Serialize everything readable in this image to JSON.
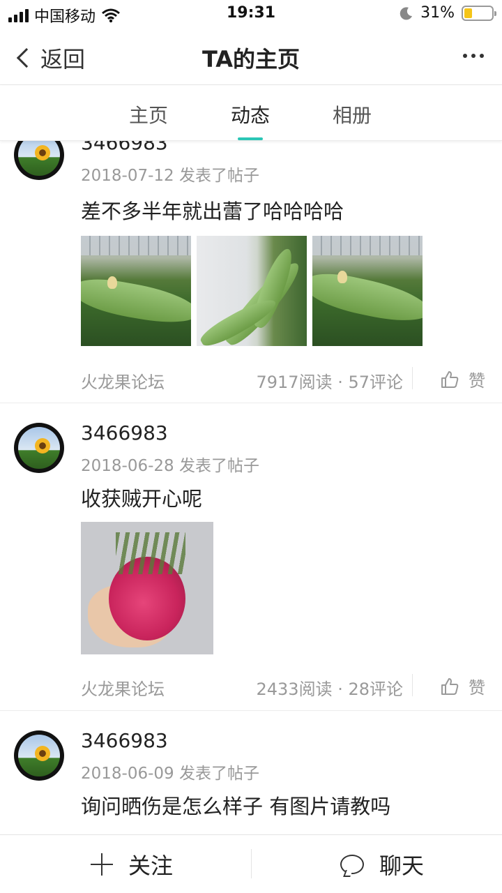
{
  "status_bar": {
    "carrier": "中国移动",
    "time": "19:31",
    "battery": "31%",
    "battery_level": 0.31,
    "icons": [
      "signal-icon",
      "wifi-icon",
      "moon-icon",
      "battery-icon"
    ]
  },
  "nav": {
    "back_label": "返回",
    "title": "TA的主页"
  },
  "tabs": [
    {
      "label": "主页",
      "active": false
    },
    {
      "label": "动态",
      "active": true
    },
    {
      "label": "相册",
      "active": false
    }
  ],
  "accent_color": "#2bc6b6",
  "posts": [
    {
      "username": "3466983",
      "date": "2018-07-12",
      "action": "发表了帖子",
      "content": "差不多半年就出蕾了哈哈哈哈",
      "forum": "火龙果论坛",
      "stats": "7917阅读 · 57评论",
      "like_label": "赞"
    },
    {
      "username": "3466983",
      "date": "2018-06-28",
      "action": "发表了帖子",
      "content": "收获贼开心呢",
      "forum": "火龙果论坛",
      "stats": "2433阅读 · 28评论",
      "like_label": "赞"
    },
    {
      "username": "3466983",
      "date": "2018-06-09",
      "action": "发表了帖子",
      "content": "询问晒伤是怎么样子 有图片请教吗"
    }
  ],
  "bottom_bar": {
    "follow_label": "关注",
    "chat_label": "聊天"
  }
}
